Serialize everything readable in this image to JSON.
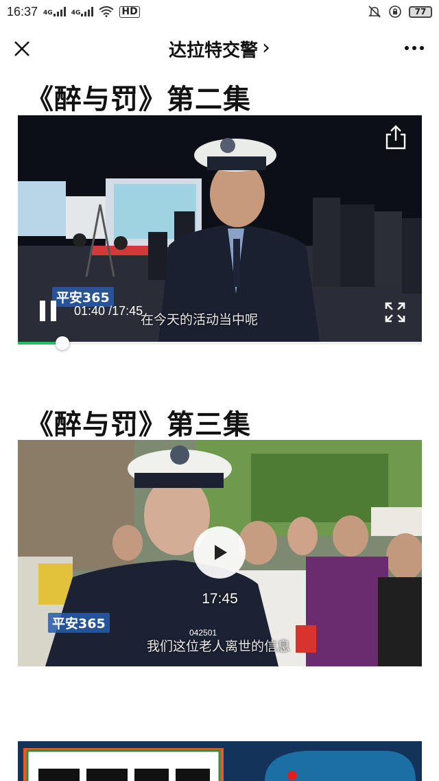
{
  "status_bar": {
    "time": "16:37",
    "network_1": "4G",
    "network_2": "4G",
    "hd_label": "HD",
    "battery": "77"
  },
  "nav": {
    "title": "达拉特交警",
    "title_arrow": "›"
  },
  "videos": [
    {
      "title": "《醉与罚》第二集",
      "brand": "平安365",
      "subtitle": "在今天的活动当中呢",
      "current_time": "01:40",
      "total_time": "/17:45",
      "progress": 0.11,
      "state": "playing"
    },
    {
      "title": "《醉与罚》第三集",
      "brand": "平安365",
      "subtitle": "我们这位老人离世的信息",
      "badge_number": "042501",
      "duration": "17:45",
      "state": "paused"
    }
  ],
  "colors": {
    "progress": "#22c05a",
    "brand_tag": "#285aaa",
    "banner_bg": "#14335a"
  }
}
